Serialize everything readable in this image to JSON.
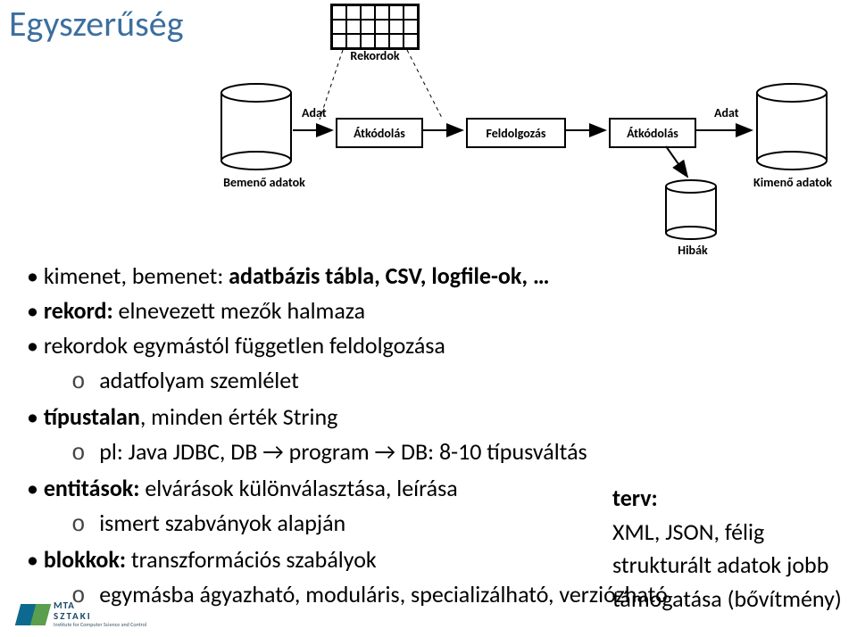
{
  "title": "Egyszerűség",
  "diagram": {
    "rekordok_label": "Rekordok",
    "bemeno_label": "Bemenő adatok",
    "kimeno_label": "Kimenő adatok",
    "hibak_label": "Hibák",
    "adat_label_left": "Adat",
    "adat_label_right": "Adat",
    "stage1": "Átkódolás",
    "stage2": "Feldolgozás",
    "stage3": "Átkódolás"
  },
  "bullets": {
    "b1_pre": "kimenet, bemenet: ",
    "b1_post": "adatbázis tábla, CSV, logfile-ok, …",
    "b2_pre": "rekord: ",
    "b2_post": "elnevezett mezők halmaza",
    "b3": "rekordok egymástól független feldolgozása",
    "b3_sub": "adatfolyam szemlélet",
    "b4_pre": "típustalan",
    "b4_post": ", minden érték String",
    "b4_sub": "pl: Java JDBC, DB → program → DB: 8-10 típusváltás",
    "b5_pre": "entitások: ",
    "b5_post": "elvárások különválasztása, leírása",
    "b5_sub": "ismert szabványok alapján",
    "b6_pre": "blokkok: ",
    "b6_post": "transzformációs szabályok",
    "b6_sub": "egymásba ágyazható, moduláris, specializálható, verziózható"
  },
  "sidebox": {
    "title": "terv:",
    "line1": "XML, JSON, félig strukturált adatok jobb támogatása (bővítmény)"
  },
  "logo": {
    "mta": "MTA",
    "sztaki": "SZTAKI",
    "sub": "Institute for Computer Science and Control"
  }
}
